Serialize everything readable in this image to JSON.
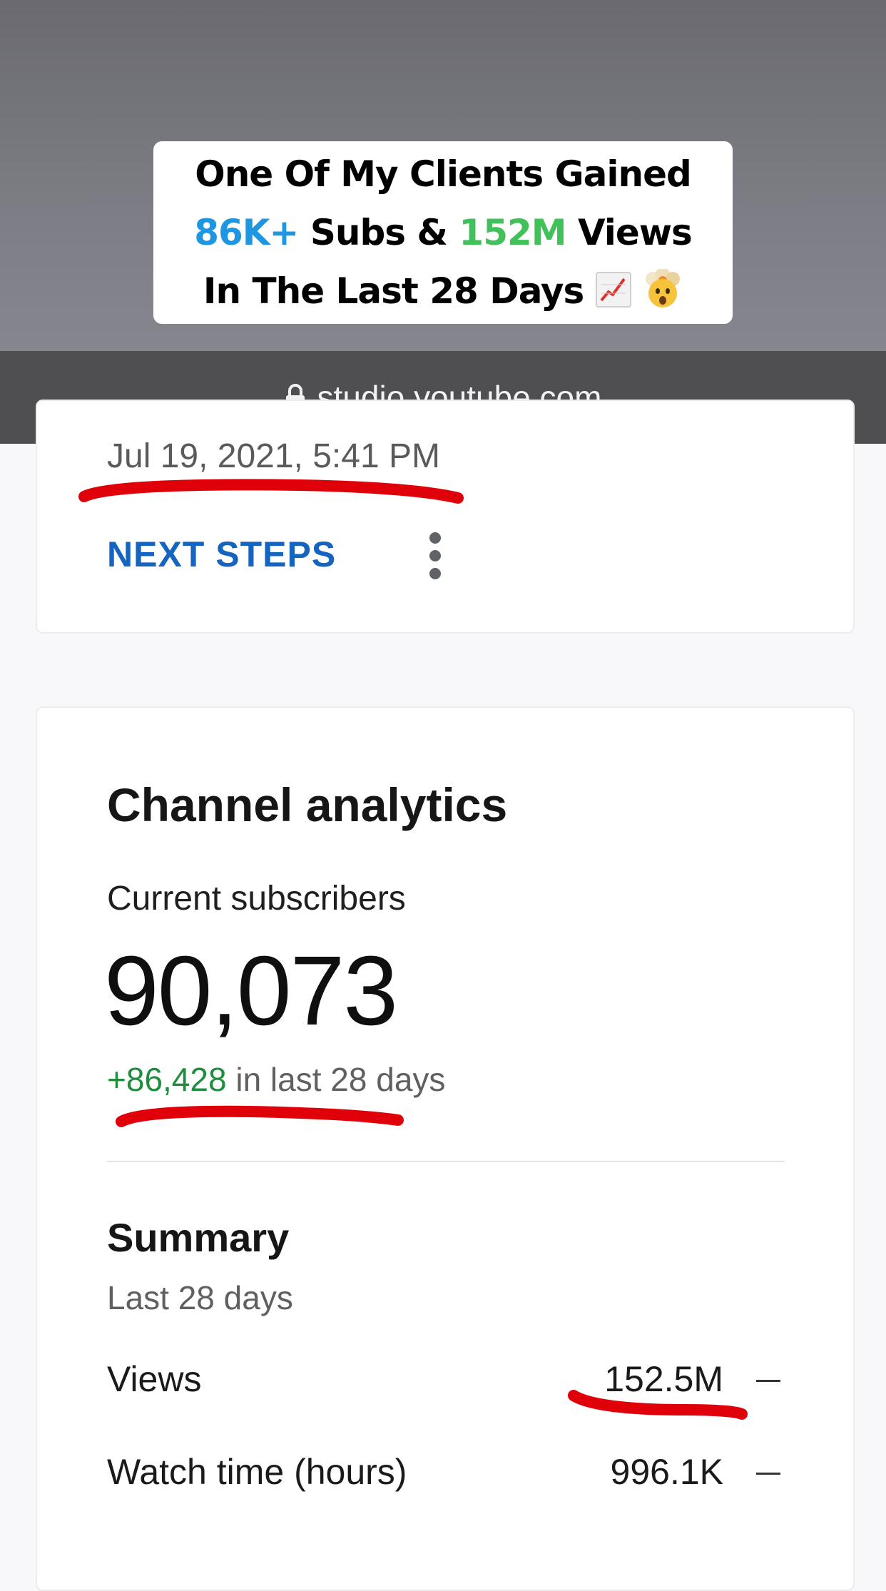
{
  "caption": {
    "line1": "One Of My Clients Gained",
    "line2_subs_count": "86K+",
    "line2_mid": " Subs & ",
    "line2_views_count": "152M",
    "line2_end": " Views",
    "line3": "In The Last 28 Days ",
    "emoji_icons": [
      "chart-increasing-icon",
      "exploding-head-icon"
    ],
    "colors": {
      "subs": "#1f96e0",
      "views": "#42c05a"
    }
  },
  "browser": {
    "url": "studio.youtube.com"
  },
  "upload_card": {
    "date": "Jul 19, 2021, 5:41 PM",
    "next_steps_label": "NEXT STEPS"
  },
  "analytics_card": {
    "title": "Channel analytics",
    "current_subscribers_label": "Current subscribers",
    "current_subscribers_value": "90,073",
    "change_value": "+86,428",
    "change_suffix": " in last 28 days",
    "summary": {
      "title": "Summary",
      "period": "Last 28 days",
      "metrics": [
        {
          "label": "Views",
          "value": "152.5M"
        },
        {
          "label": "Watch time (hours)",
          "value": "996.1K"
        }
      ]
    }
  },
  "annotation_color": "#e0000a"
}
